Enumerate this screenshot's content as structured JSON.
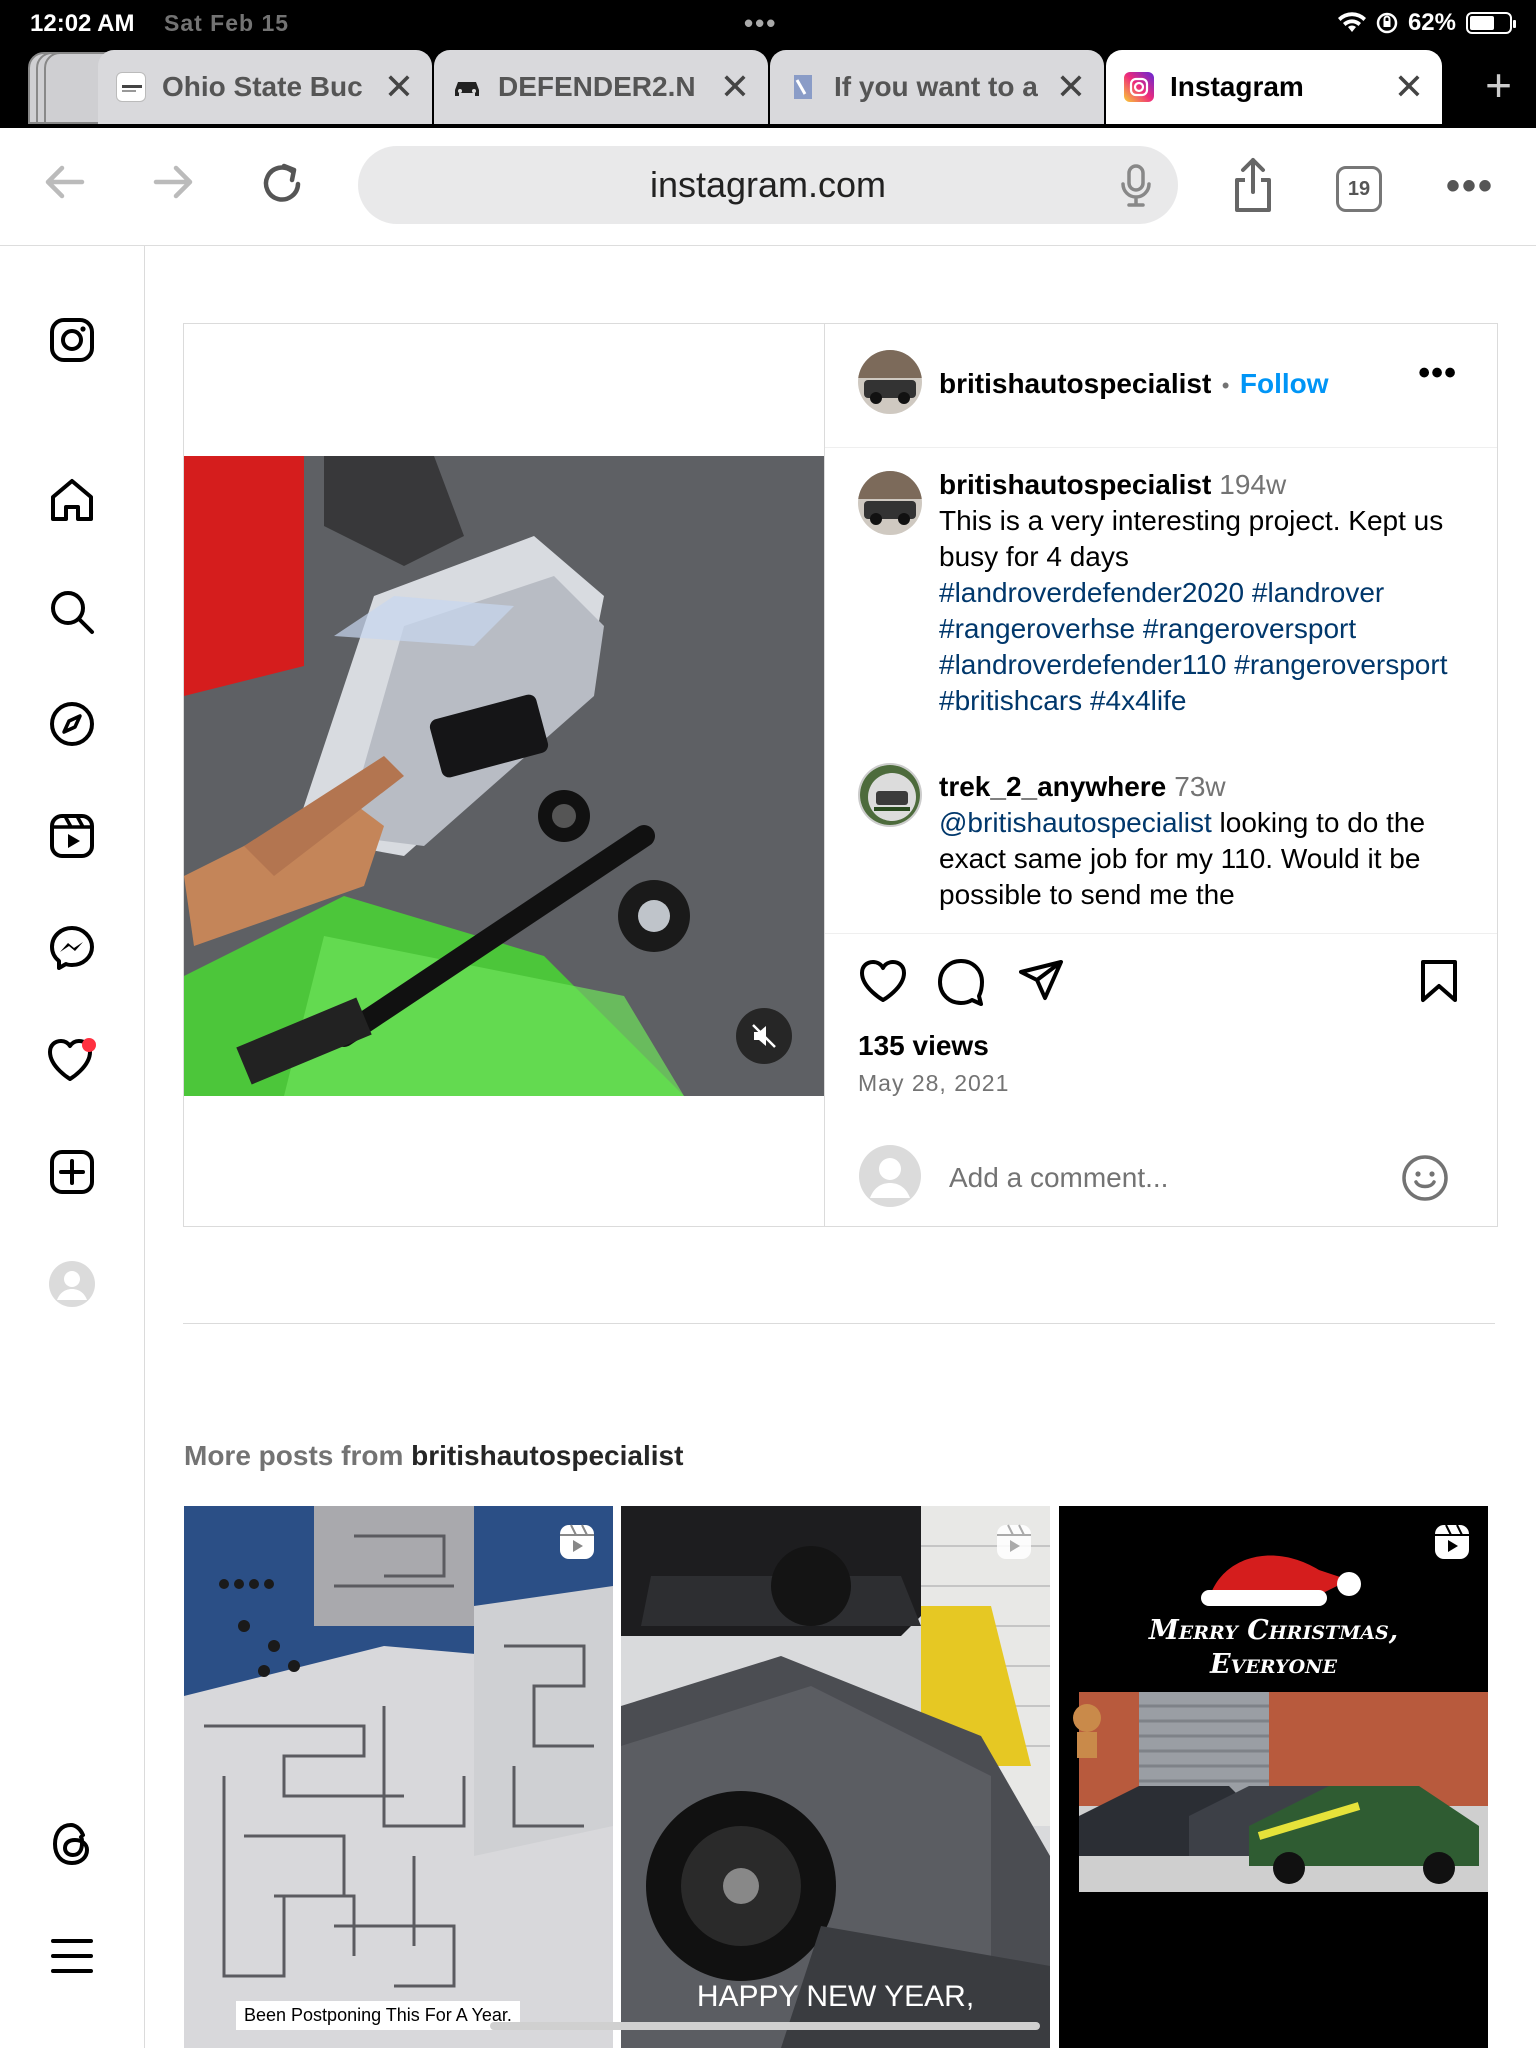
{
  "status_bar": {
    "time": "12:02 AM",
    "date": "Sat Feb 15",
    "battery": "62%",
    "battery_level": 0.62
  },
  "tabs": [
    {
      "title": "Ohio State Buc",
      "active": false
    },
    {
      "title": "DEFENDER2.N",
      "active": false
    },
    {
      "title": "If you want to a",
      "active": false
    },
    {
      "title": "Instagram",
      "active": true
    }
  ],
  "toolbar": {
    "url": "instagram.com",
    "tab_count": "19"
  },
  "sidebar": {
    "items": [
      "instagram-logo",
      "home",
      "search",
      "explore",
      "reels",
      "messenger",
      "notifications",
      "create",
      "profile",
      "threads",
      "menu"
    ]
  },
  "post": {
    "author": "britishautospecialist",
    "separator": "•",
    "follow_label": "Follow",
    "caption": {
      "username": "britishautospecialist",
      "age": "194w",
      "text": "This is a very interesting project. Kept us busy for 4 days",
      "hashtags": "#landroverdefender2020 #landrover #rangeroverhse #rangeroversport #landroverdefender110 #rangeroversport #britishcars #4x4life"
    },
    "comment": {
      "username": "trek_2_anywhere",
      "age": "73w",
      "mention": "@britishautospecialist",
      "text": " looking to do the exact same job for my 110. Would it be possible to send me the"
    },
    "views": "135 views",
    "date": "May 28, 2021",
    "add_comment_placeholder": "Add a comment..."
  },
  "more_posts": {
    "prefix": "More posts from ",
    "username": "britishautospecialist",
    "items": [
      {
        "caption": "Been Postponing This For A Year."
      },
      {
        "caption": "HAPPY NEW YEAR,"
      },
      {
        "caption_line1": "Merry Christmas,",
        "caption_line2": "Everyone"
      }
    ]
  },
  "colors": {
    "link_blue": "#0095f6",
    "hashtag": "#00376b",
    "notification_dot": "#ff3040"
  }
}
